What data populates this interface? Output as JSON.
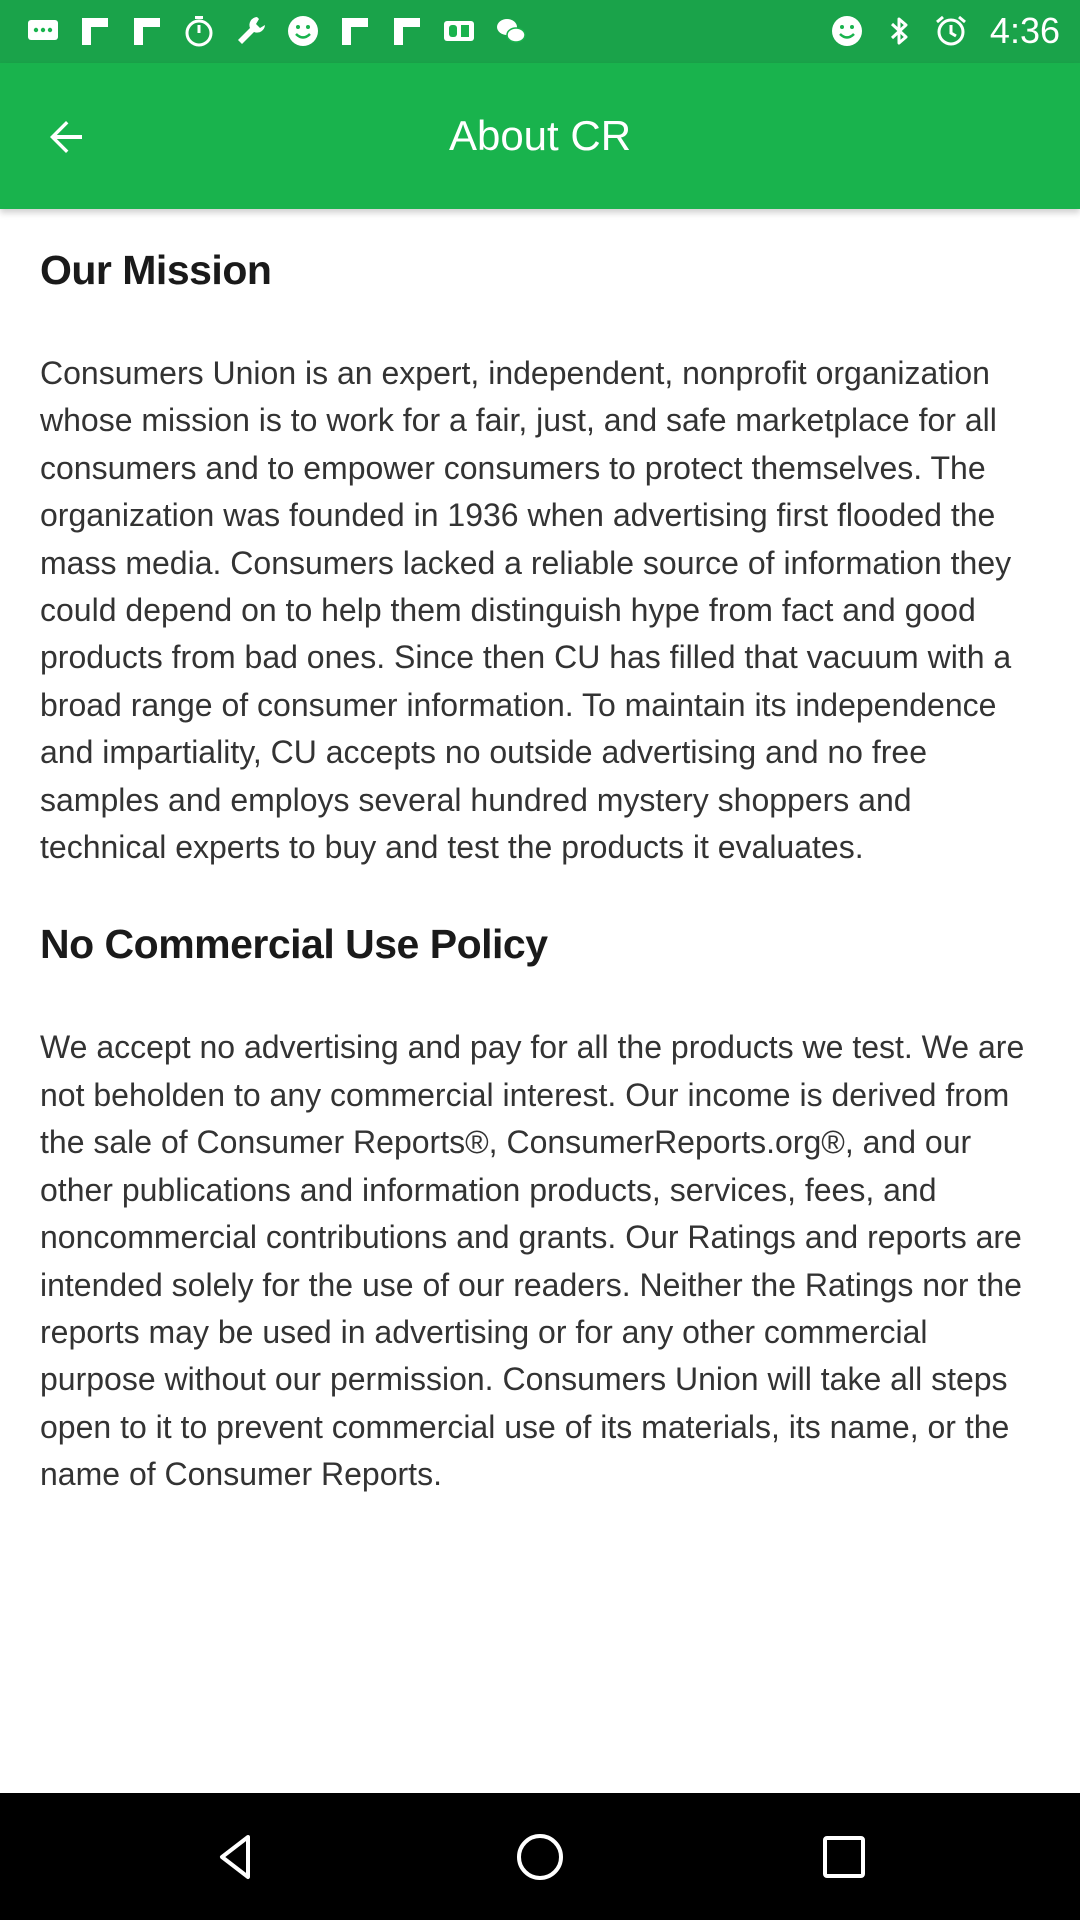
{
  "status_bar": {
    "time": "4:36",
    "left_icons": [
      "chat-icon",
      "flipboard-icon",
      "flipboard-icon",
      "stopwatch-icon",
      "wrench-icon",
      "smiley-icon",
      "flipboard-icon",
      "flipboard-icon",
      "qq-icon",
      "wechat-icon"
    ],
    "right_icons": [
      "smiley-icon",
      "bluetooth-icon",
      "alarm-icon"
    ]
  },
  "app_bar": {
    "title": "About CR",
    "back_icon": "arrow-left-icon",
    "color": "#19b34d"
  },
  "sections": [
    {
      "heading": "Our Mission",
      "body": "Consumers Union is an expert, independent, nonprofit organization whose mission is to work for a fair, just, and safe marketplace for all consumers and to empower consumers to protect themselves. The organization was founded in 1936 when advertising first flooded the mass media. Consumers lacked a reliable source of information they could depend on to help them distinguish hype from fact and good products from bad ones. Since then CU has filled that vacuum with a broad range of consumer information. To maintain its independence and impartiality, CU accepts no outside advertising and no free samples and employs several hundred mystery shoppers and technical experts to buy and test the products it evaluates."
    },
    {
      "heading": "No Commercial Use Policy",
      "body": "We accept no advertising and pay for all the products we test. We are not beholden to any commercial interest. Our income is derived from the sale of Consumer Reports®, ConsumerReports.org®, and our other publications and information products, services, fees, and noncommercial contributions and grants. Our Ratings and reports are intended solely for the use of our readers. Neither the Ratings nor the reports may be used in advertising or for any other commercial purpose without our permission. Consumers Union will take all steps open to it to prevent commercial use of its materials, its name, or the name of Consumer Reports."
    }
  ],
  "nav_bar": {
    "buttons": [
      "back-triangle-icon",
      "home-circle-icon",
      "recents-square-icon"
    ]
  }
}
